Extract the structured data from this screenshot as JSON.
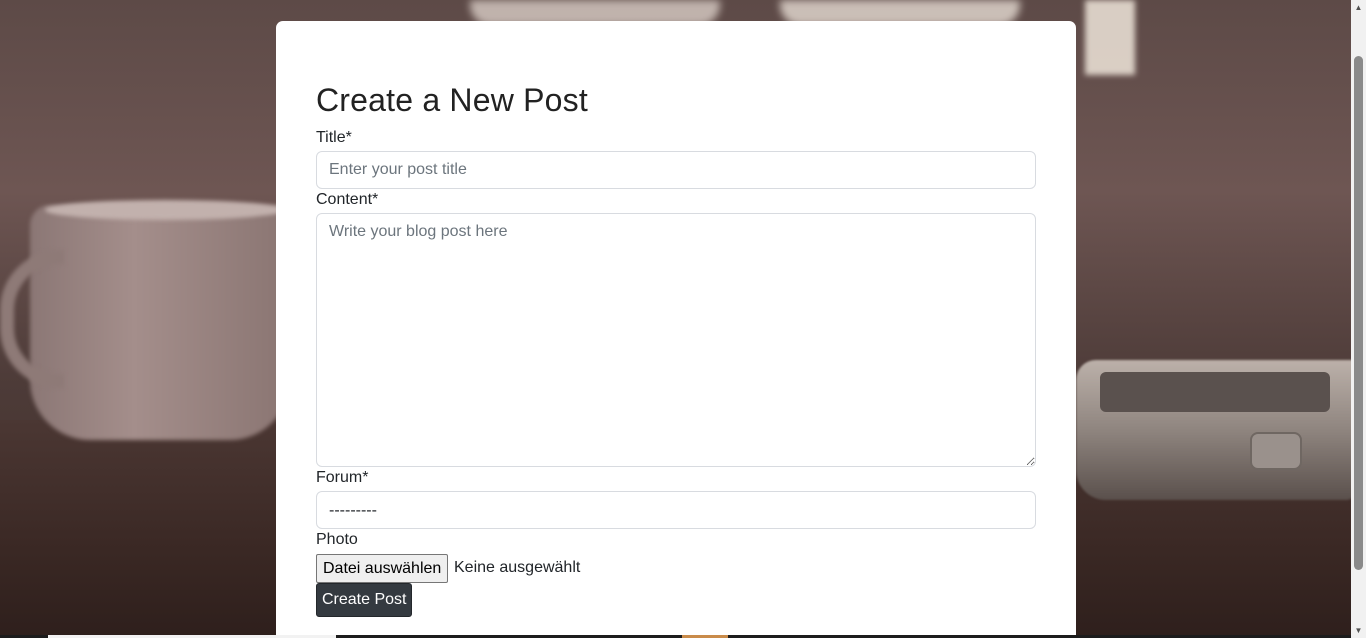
{
  "page": {
    "heading": "Create a New Post"
  },
  "form": {
    "title_label": "Title*",
    "title_placeholder": "Enter your post title",
    "content_label": "Content*",
    "content_placeholder": "Write your blog post here",
    "forum_label": "Forum*",
    "forum_selected": "---------",
    "photo_label": "Photo",
    "file_button": "Datei auswählen",
    "file_status": "Keine ausgewählt",
    "submit_label": "Create Post"
  },
  "colors": {
    "submit_bg": "#343a40",
    "card_bg": "#ffffff"
  },
  "icons": {
    "scroll_up": "chevron-up-icon",
    "scroll_down": "chevron-down-icon"
  }
}
